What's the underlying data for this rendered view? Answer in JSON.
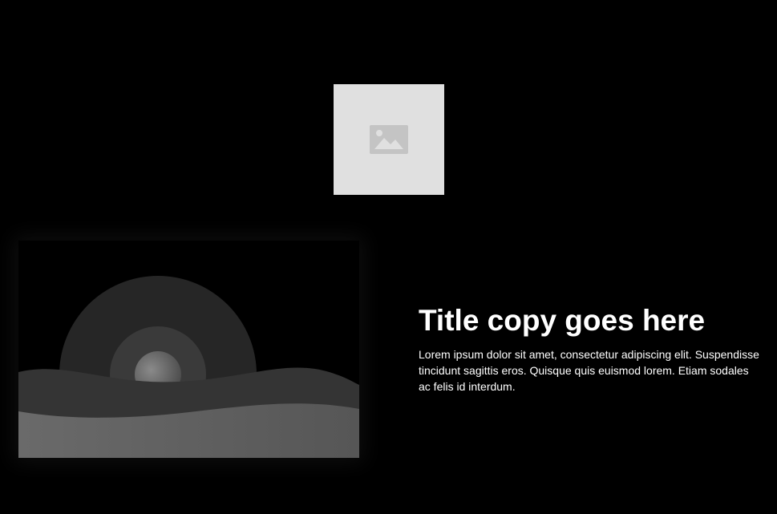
{
  "logo": {
    "icon": "image-placeholder-icon"
  },
  "hero": {
    "icon": "landscape-illustration"
  },
  "content": {
    "title": "Title copy goes here",
    "body": "Lorem ipsum dolor sit amet, consectetur adipiscing elit. Suspendisse tincidunt sagittis eros. Quisque quis euismod lorem. Etiam sodales ac felis id interdum."
  },
  "colors": {
    "background": "#000000",
    "placeholder_bg": "#e0e0e0",
    "placeholder_icon": "#c4c4c4",
    "text": "#ffffff"
  }
}
